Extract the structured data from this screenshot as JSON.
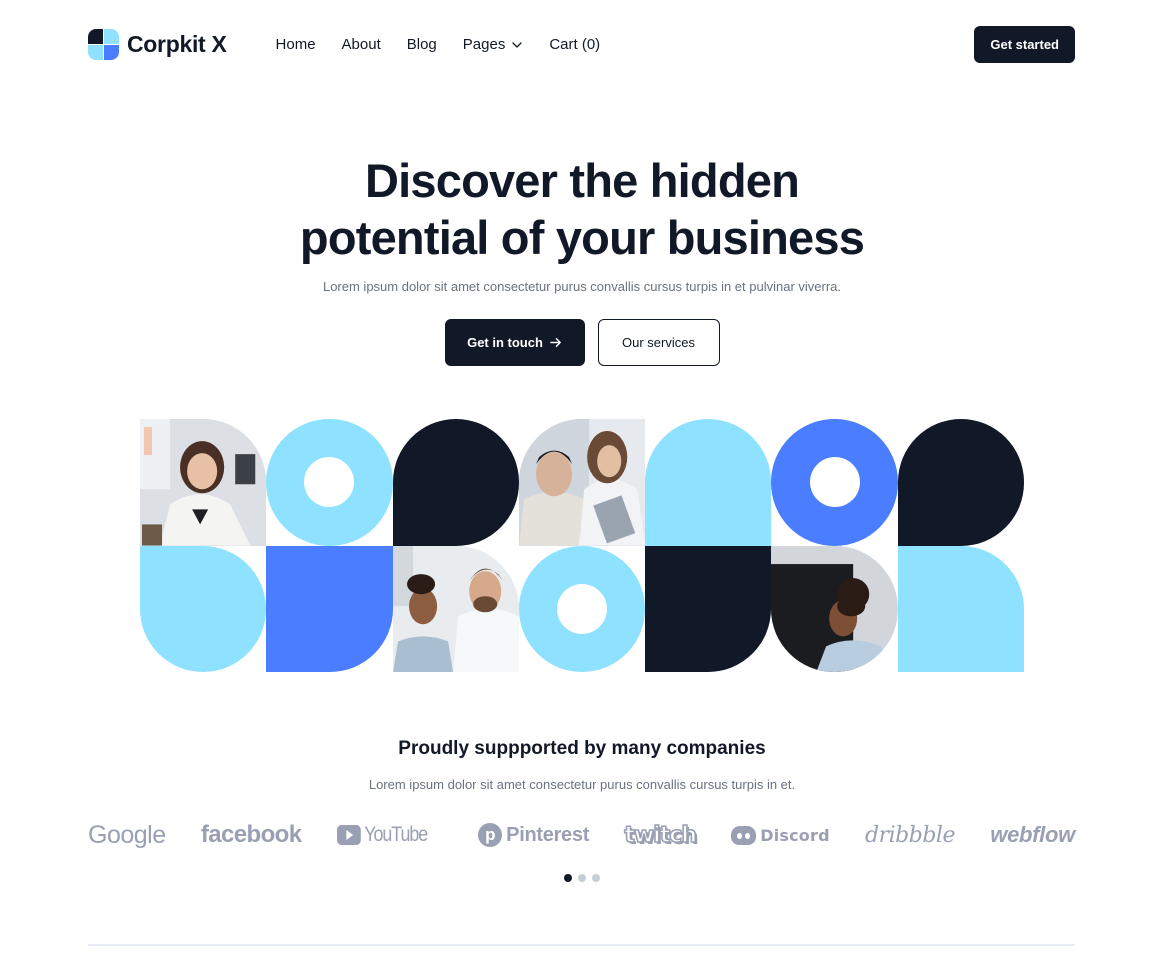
{
  "brand": {
    "name": "Corpkit X"
  },
  "nav": {
    "items": [
      {
        "label": "Home"
      },
      {
        "label": "About"
      },
      {
        "label": "Blog"
      },
      {
        "label": "Pages",
        "has_dropdown": true
      },
      {
        "label": "Cart (0)"
      }
    ],
    "cta_label": "Get started"
  },
  "hero": {
    "title_line1": "Discover the hidden",
    "title_line2": "potential of your business",
    "subtitle": "Lorem ipsum dolor sit amet consectetur purus convallis cursus turpis in et pulvinar viverra.",
    "primary_cta": "Get in touch",
    "primary_cta_icon": "arrow-right-icon",
    "secondary_cta": "Our services"
  },
  "mosaic": {
    "tiles": [
      {
        "kind": "photo",
        "subject": "woman at desk"
      },
      {
        "kind": "ring",
        "color": "#8ee2ff"
      },
      {
        "kind": "shape",
        "color": "#111827"
      },
      {
        "kind": "photo",
        "subject": "two colleagues looking at tablet"
      },
      {
        "kind": "shape",
        "color": "#8ee2ff"
      },
      {
        "kind": "ring",
        "color": "#4a7dff"
      },
      {
        "kind": "shape",
        "color": "#111827"
      },
      {
        "kind": "shape",
        "color": "#8ee2ff"
      },
      {
        "kind": "shape",
        "color": "#4a7dff"
      },
      {
        "kind": "photo",
        "subject": "woman and man reviewing work"
      },
      {
        "kind": "ring",
        "color": "#8ee2ff"
      },
      {
        "kind": "shape",
        "color": "#111827"
      },
      {
        "kind": "photo",
        "subject": "woman in profile"
      },
      {
        "kind": "shape",
        "color": "#8ee2ff"
      }
    ]
  },
  "supporters": {
    "title": "Proudly suppported by many companies",
    "subtitle": "Lorem ipsum dolor sit amet consectetur purus convallis cursus turpis in et.",
    "logos": [
      "Google",
      "facebook",
      "YouTube",
      "Pinterest",
      "twitch",
      "Discord",
      "dribbble",
      "webflow"
    ],
    "carousel": {
      "pages": 3,
      "active_index": 0
    }
  },
  "colors": {
    "dark": "#111827",
    "light_blue": "#8ee2ff",
    "blue": "#4a7dff",
    "muted_text": "#6b7280",
    "logo_gray": "#9aa0b3"
  }
}
